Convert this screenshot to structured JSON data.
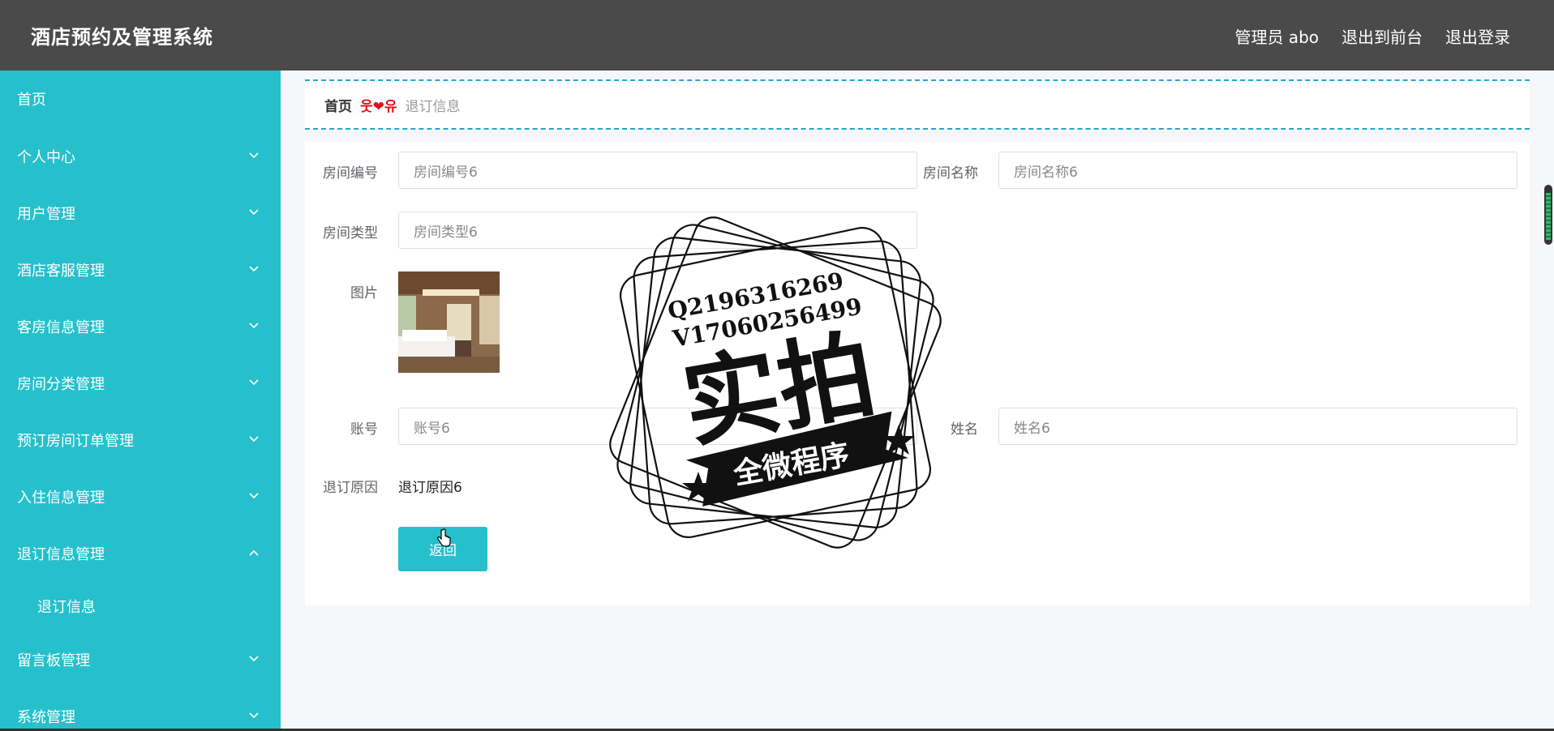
{
  "header": {
    "title": "酒店预约及管理系统",
    "user_label": "管理员 abo",
    "to_frontend": "退出到前台",
    "logout": "退出登录"
  },
  "sidebar": {
    "items": [
      {
        "label": "首页"
      },
      {
        "label": "个人中心"
      },
      {
        "label": "用户管理"
      },
      {
        "label": "酒店客服管理"
      },
      {
        "label": "客房信息管理"
      },
      {
        "label": "房间分类管理"
      },
      {
        "label": "预订房间订单管理"
      },
      {
        "label": "入住信息管理"
      },
      {
        "label": "退订信息管理"
      },
      {
        "label": "退订信息"
      },
      {
        "label": "留言板管理"
      },
      {
        "label": "系统管理"
      }
    ]
  },
  "breadcrumb": {
    "home": "首页",
    "separator": "웃❤유",
    "current": "退订信息"
  },
  "form": {
    "room_no_label": "房间编号",
    "room_no_value": "房间编号6",
    "room_name_label": "房间名称",
    "room_name_value": "房间名称6",
    "room_type_label": "房间类型",
    "room_type_value": "房间类型6",
    "image_label": "图片",
    "account_label": "账号",
    "account_value": "账号6",
    "name_label": "姓名",
    "name_value": "姓名6",
    "reason_label": "退订原因",
    "reason_value": "退订原因6",
    "back_button": "返回"
  },
  "watermark": {
    "line1": "Q2196316269",
    "line2": "V17060256499",
    "big": "实拍",
    "banner": "全微程序"
  },
  "colors": {
    "topbar": "#4a4a4a",
    "sidebar": "#26c0cc",
    "accent": "#26c0cc",
    "breadcrumb_border": "#26a7c7"
  }
}
